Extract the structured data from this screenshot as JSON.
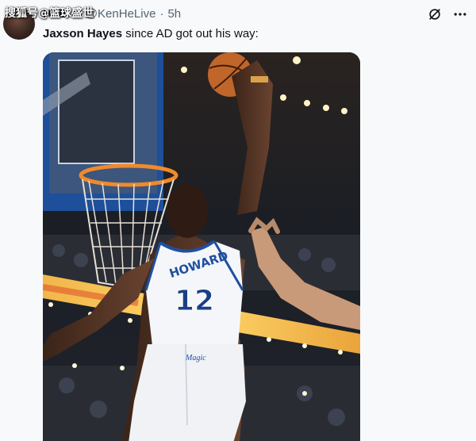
{
  "watermark": "搜狐号@篮球盛世",
  "tweet": {
    "display_name": "HuB",
    "handle": "@KenHeLive",
    "separator": "·",
    "time": "5h",
    "text_bold": "Jaxson Hayes",
    "text_rest": " since AD got out his way:"
  },
  "media": {
    "jersey_name": "HOWARD",
    "jersey_number": "12",
    "shorts_logo": "Magic"
  },
  "colors": {
    "text": "#0f1419",
    "secondary": "#536471",
    "verified": "#1d9bf0",
    "jersey_trim": "#1f4fa0"
  },
  "icons": [
    "verified-badge-icon",
    "grok-icon",
    "more-icon"
  ]
}
